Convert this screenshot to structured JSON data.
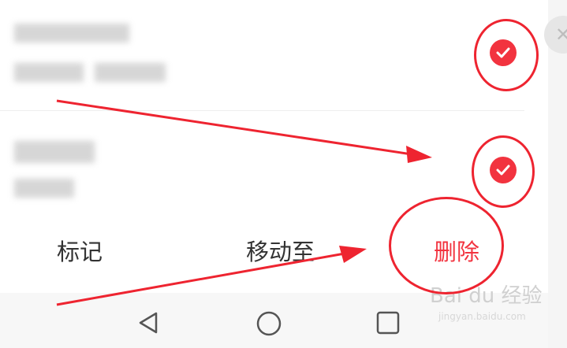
{
  "actions": {
    "mark_label": "标记",
    "move_label": "移动至",
    "delete_label": "删除"
  },
  "watermark": {
    "brand": "Bai du 经验",
    "url": "jingyan.baidu.com"
  },
  "icons": {
    "close": "close-icon",
    "check": "check-icon",
    "back": "back-triangle-icon",
    "home": "home-circle-icon",
    "recent": "recent-square-icon"
  },
  "colors": {
    "accent": "#f2333f",
    "annotation": "#ee2430"
  }
}
